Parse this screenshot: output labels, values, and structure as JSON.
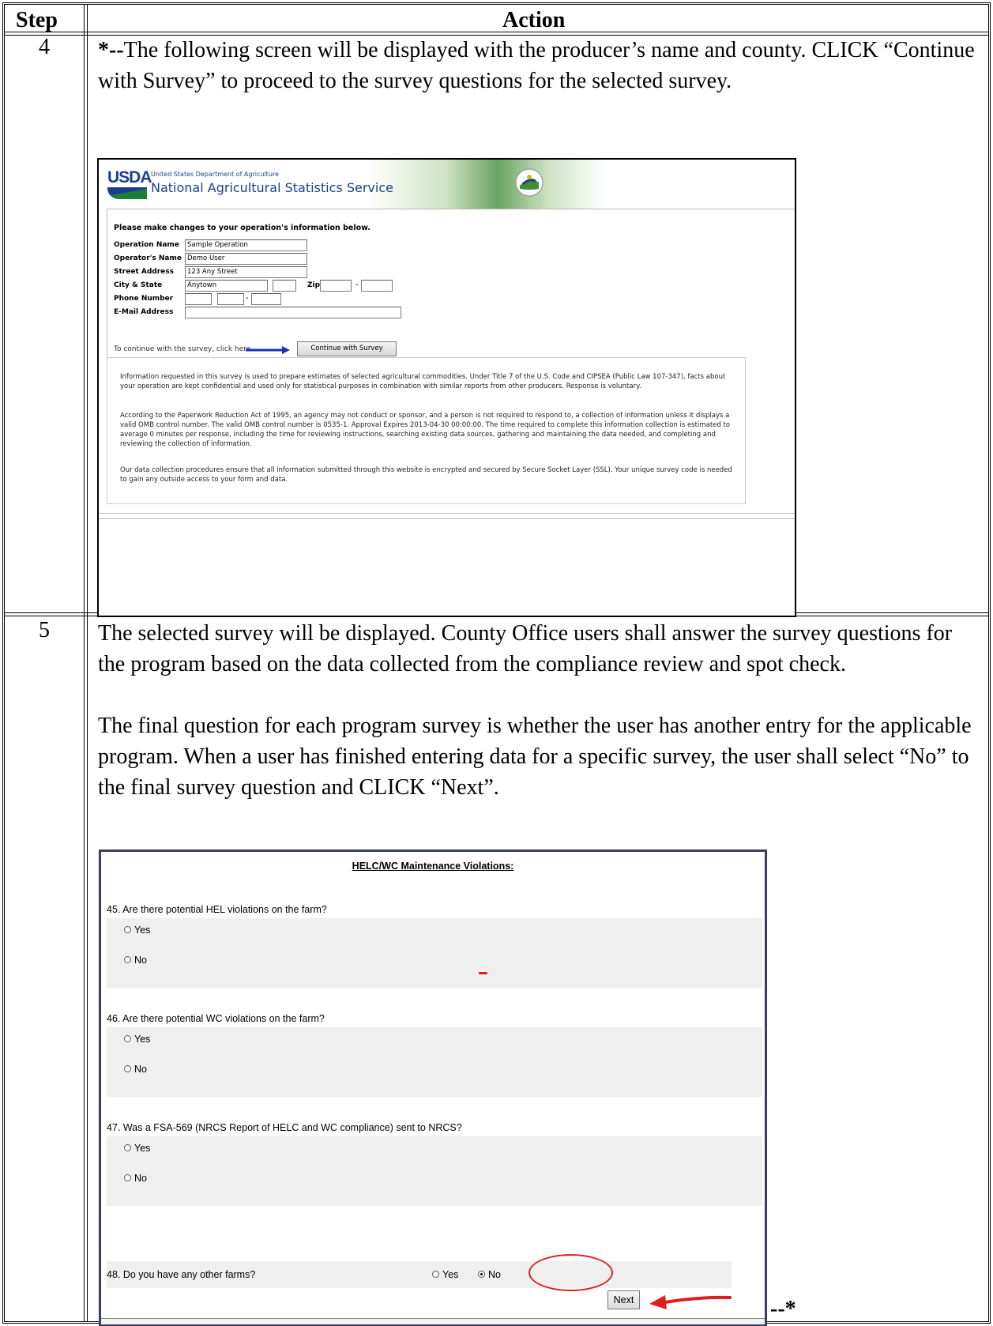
{
  "table": {
    "header_step": "Step",
    "header_action": "Action"
  },
  "step4": {
    "number": "4",
    "text_mark": "*--",
    "text": "The following screen will be displayed with the producer’s name and county. CLICK “Continue with Survey” to proceed to the survey questions for the selected survey."
  },
  "nass_screen": {
    "logo_text": "USDA",
    "dept": "United States Department of Agriculture",
    "agency": "National Agricultural Statistics Service",
    "prompt": "Please make changes to your operation's information below.",
    "fields": {
      "operation_name_label": "Operation Name",
      "operation_name_value": "Sample Operation",
      "operator_name_label": "Operator's Name",
      "operator_name_value": "Demo User",
      "street_label": "Street Address",
      "street_value": "123 Any Street",
      "city_state_label": "City & State",
      "city_value": "Anytown",
      "zip_label": "Zip",
      "phone_label": "Phone Number",
      "email_label": "E-Mail Address"
    },
    "continue_text": "To continue with the survey, click here",
    "continue_button": "Continue with Survey",
    "notice": [
      "Information requested in this survey is used to prepare estimates of selected agricultural commodities. Under Title 7 of the U.S. Code and CIPSEA (Public Law 107-347), facts about your operation are kept confidential and used only for statistical purposes in combination with similar reports from other producers. Response is voluntary.",
      "According to the Paperwork Reduction Act of 1995, an agency may not conduct or sponsor, and a person is not required to respond to, a collection of information unless it displays a valid OMB control number. The valid OMB control number is 0535-1. Approval Expires 2013-04-30 00:00:00. The time required to complete this information collection is estimated to average 0 minutes per response, including the time for reviewing instructions, searching existing data sources, gathering and maintaining the data needed, and completing and reviewing the collection of information.",
      "Our data collection procedures ensure that all information submitted through this website is encrypted and secured by Secure Socket Layer (SSL). Your unique survey code is needed to gain any outside access to your form and data."
    ]
  },
  "step5": {
    "number": "5",
    "para1": "The selected survey will be displayed. County Office users shall answer the survey questions for the program based on the data collected from the compliance review and spot check.",
    "para2": "The final question for each program survey is whether the user has another entry for the applicable program. When a user has finished entering data for a specific survey, the user shall select “No” to the final survey question and CLICK “Next”."
  },
  "survey_screen": {
    "title": "HELC/WC Maintenance Violations:",
    "questions": [
      {
        "label": "45. Are there potential HEL violations on the farm?",
        "yes": "Yes",
        "no": "No"
      },
      {
        "label": "46. Are there potential WC violations on the farm?",
        "yes": "Yes",
        "no": "No"
      },
      {
        "label": "47. Was a FSA-569 (NRCS Report of HELC and WC compliance) sent to NRCS?",
        "yes": "Yes",
        "no": "No"
      }
    ],
    "q48": {
      "label": "48. Do you have any other farms?",
      "yes": "Yes",
      "no": "No",
      "selected": "No"
    },
    "next_button": "Next"
  },
  "end_mark": "--*"
}
